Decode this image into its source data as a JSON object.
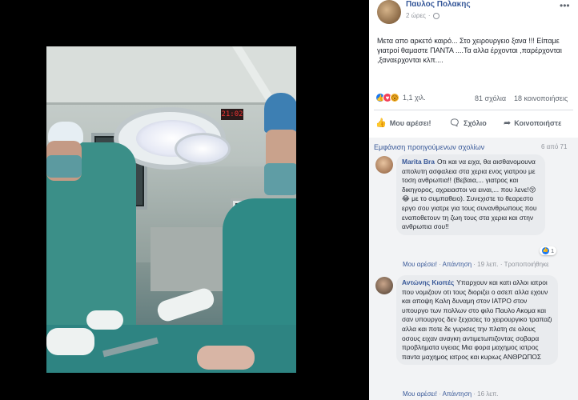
{
  "post": {
    "author": "Παυλος Πολακης",
    "time": "2 ώρες",
    "audience_icon": "globe-icon",
    "more_icon": "ellipsis-icon",
    "text": "Μετα απο αρκετό καιρό... Στο χειρουργειο ξανα !!! Είπαμε γιατροί θαμαστε ΠΑΝΤΑ ....Τα αλλα έρχονται ,παρέρχονται ,ξαναερχονται κλπ....",
    "reactions_count": "1,1 χιλ.",
    "comments_count": "81 σχόλια",
    "shares_count": "18 κοινοποιήσεις"
  },
  "actions": {
    "like": "Μου αρέσει!",
    "comment": "Σχόλιο",
    "share": "Κοινοποιήστε"
  },
  "comments_header": {
    "view_previous": "Εμφάνιση προηγούμενων σχολίων",
    "count": "6 από 71"
  },
  "comments": [
    {
      "author": "Marita Bra",
      "text": "Οτι και να ειχα, θα αισθανομουνα απολυτη ασφαλεια στα χερια ενος γιατρου με τοση ανθρωπια!! (Βεβαια,... γιατρος και δικηγορος, αχρειαστοι να ειναι,... που λενε!😚😂 με το συμπαθειο). Συνεχιστε το θεαρεστο εργο σου γιατρε για τους συνανθρωπους που εναποθετουν τη ζωη τους στα χερια και στην ανθρωπια σου!!",
      "like": "Μου αρέσει!",
      "reply": "Απάντηση",
      "time": "19 λεπ.",
      "edited": "Τροποποιήθηκε",
      "likes": "1"
    },
    {
      "author": "Αντώνης Κιοπές",
      "text": "Υπαρχουν και κατι αλλοι ιατροι που νομιζουν οτι τους διοριζει ο ασεπ αλλα εχουν και αποψη Καλη δυναμη στον ΙΑΤΡΟ στον υπουργο των πολλων στο φιλο Παυλο Ακομα και σαν υπουργος δεν ξεχασες το χειρουργικο τραπαζι αλλα και ποτε δε γυρισες την πλατη σε ολους οσους ειχαν αναγκη αντιμετωπιζοντας σοβαρα προβληματα υγειας Μια φορα μαχημος ιατρος παντα μαχημος ιατρος και κυριως ΑΝΘΡΩΠΟΣ",
      "like": "Μου αρέσει!",
      "reply": "Απάντηση",
      "time": "16 λεπ."
    }
  ],
  "photo": {
    "clock": "21:02"
  }
}
